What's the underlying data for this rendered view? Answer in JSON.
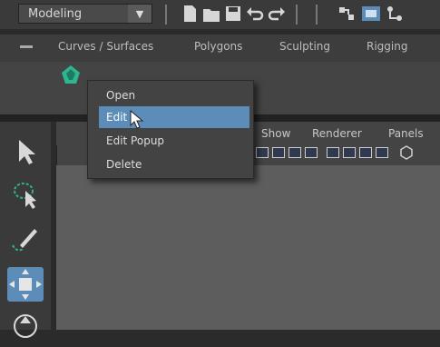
{
  "app": {
    "mode_selector": {
      "value": "Modeling",
      "arrow": "▼"
    }
  },
  "shelf": {
    "tabs": [
      {
        "label": "Curves / Surfaces"
      },
      {
        "label": "Polygons"
      },
      {
        "label": "Sculpting"
      },
      {
        "label": "Rigging"
      }
    ]
  },
  "viewport": {
    "menu": [
      {
        "label": "Show"
      },
      {
        "label": "Renderer"
      },
      {
        "label": "Panels"
      }
    ]
  },
  "context_menu": {
    "items": [
      {
        "label": "Open",
        "active": false
      },
      {
        "label": "Edit",
        "active": true
      },
      {
        "label": "Edit Popup",
        "active": false
      },
      {
        "label": "Delete",
        "active": false
      }
    ]
  },
  "colors": {
    "accent": "#5b8db8",
    "shelf_icon": "#2fb58f"
  },
  "icons": {
    "topbar": [
      "new-scene-icon",
      "open-scene-icon",
      "save-scene-icon",
      "undo-icon",
      "redo-icon",
      "select-by-hierarchy-icon",
      "select-by-object-icon",
      "select-by-component-icon"
    ],
    "toolbox": [
      "select-tool-icon",
      "lasso-tool-icon",
      "paint-select-tool-icon",
      "move-tool-icon",
      "rotate-tool-icon"
    ]
  }
}
